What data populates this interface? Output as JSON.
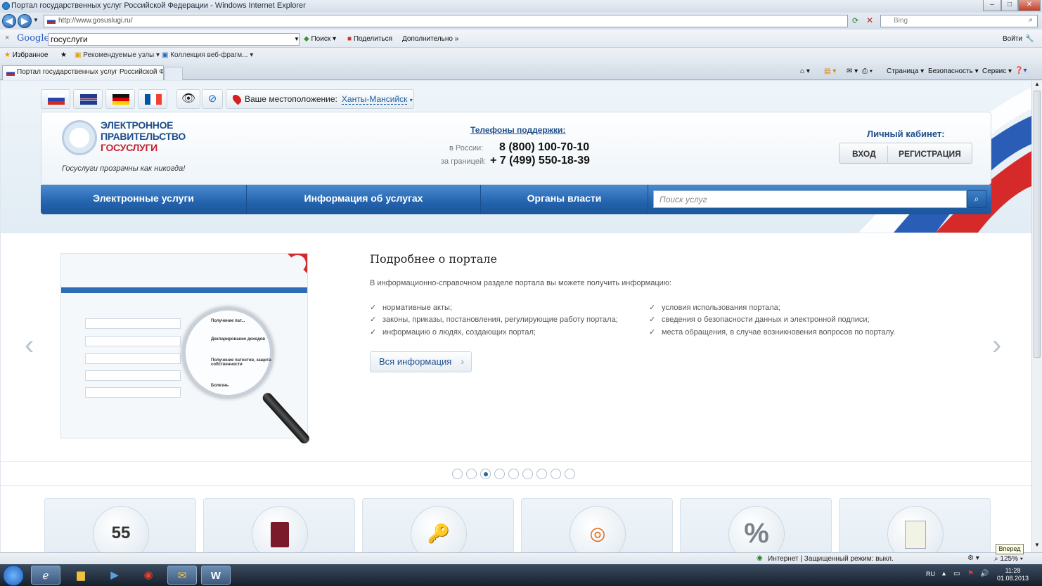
{
  "window": {
    "title": "Портал государственных услуг Российской Федерации - Windows Internet Explorer",
    "controls": [
      "–",
      "□",
      "✕"
    ]
  },
  "address": {
    "url": "http://www.gosuslugi.ru/",
    "bing_placeholder": "Bing"
  },
  "google_bar": {
    "logo": "Google",
    "query": "госуслуги",
    "search": "Поиск",
    "share": "Поделиться",
    "more": "Дополнительно »",
    "signin": "Войти"
  },
  "favorites": {
    "fav": "Избранное",
    "recommended": "Рекомендуемые узлы",
    "gallery": "Коллекция веб-фрагм..."
  },
  "tab": {
    "title": "Портал государственных услуг Российской Фе..."
  },
  "commandbar": {
    "page": "Страница",
    "safety": "Безопасность",
    "tools": "Сервис"
  },
  "site": {
    "location_label": "Ваше местоположение:",
    "location_city": "Ханты-Мансийск",
    "logo_line1": "ЭЛЕКТРОННОЕ",
    "logo_line2": "ПРАВИТЕЛЬСТВО",
    "logo_line3": "ГОСУСЛУГИ",
    "slogan": "Госуслуги прозрачны как никогда!",
    "support_title": "Телефоны поддержки",
    "support_ru_label": "в России:",
    "support_ru": "8 (800) 100-70-10",
    "support_abroad_label": "за границей:",
    "support_abroad": "+ 7 (499) 550-18-39",
    "cabinet_title": "Личный кабинет:",
    "login": "ВХОД",
    "register": "РЕГИСТРАЦИЯ",
    "menu": [
      "Электронные услуги",
      "Информация об услугах",
      "Органы власти"
    ],
    "search_placeholder": "Поиск услуг"
  },
  "slide": {
    "title": "Подробнее о портале",
    "intro": "В информационно-справочном разделе портала вы можете получить информацию:",
    "left_items": [
      "нормативные акты;",
      "законы, приказы, постановления, регулирующие работу портала;",
      "информацию о людях, создающих портал;"
    ],
    "right_items": [
      "условия использования портала;",
      "сведения о безопасности данных и электронной подписи;",
      "места обращения, в случае возникновения вопросов по порталу."
    ],
    "button": "Вся информация",
    "lens_items": [
      "Получение пат...",
      "Декларирование доходов",
      "Получение патентов, защита собственности",
      "Болезнь"
    ],
    "active_dot": 3,
    "dot_count": 9
  },
  "cards": [
    "55",
    "",
    "",
    "",
    "%",
    ""
  ],
  "status": {
    "zone": "Интернет | Защищенный режим: выкл.",
    "zoom": "125%",
    "tooltip": "Вперед"
  },
  "taskbar": {
    "lang": "RU",
    "time": "11:28",
    "date": "01.08.2013"
  }
}
